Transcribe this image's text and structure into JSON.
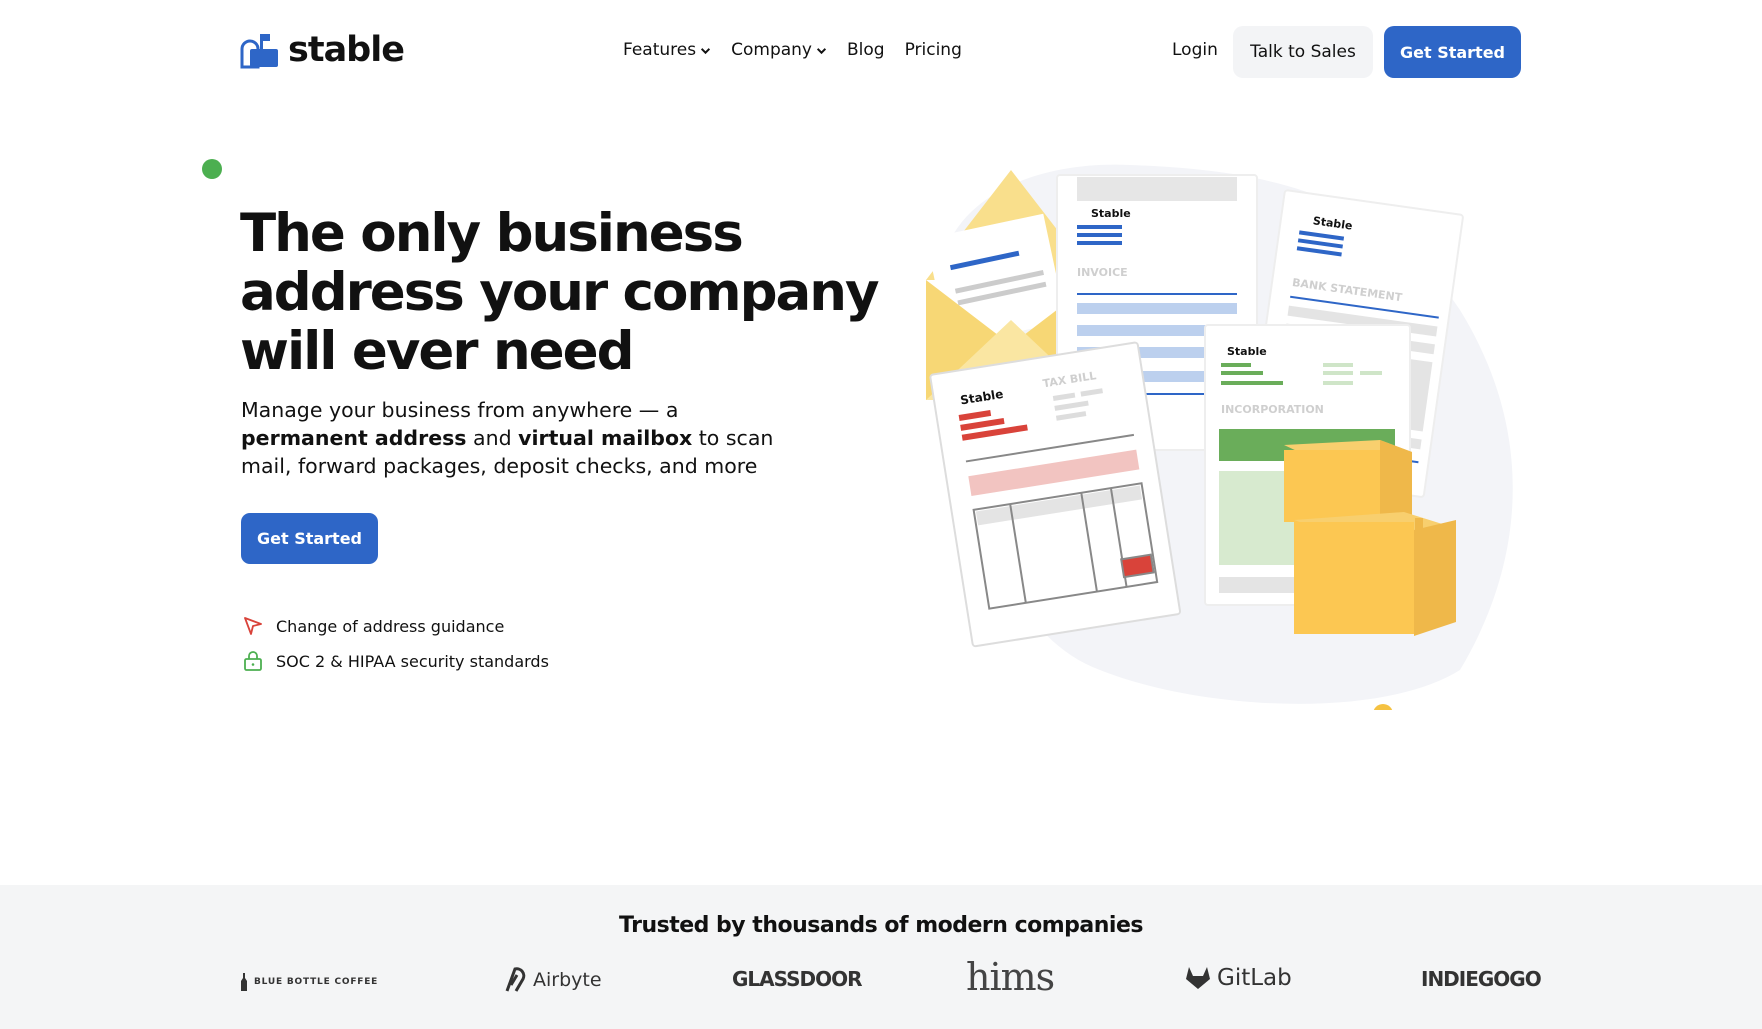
{
  "nav": {
    "logo_text": "stable",
    "menu": [
      {
        "label": "Features",
        "dropdown": true
      },
      {
        "label": "Company",
        "dropdown": true
      },
      {
        "label": "Blog",
        "dropdown": false
      },
      {
        "label": "Pricing",
        "dropdown": false
      }
    ],
    "login_label": "Login",
    "talk_label": "Talk to Sales",
    "start_label": "Get Started"
  },
  "hero": {
    "title": "The only business address your company will ever need",
    "subtitle_parts": [
      "Manage your business from anywhere — a ",
      "permanent address",
      " and ",
      "virtual mailbox",
      " to scan mail, forward packages, deposit checks, and more"
    ],
    "cta_label": "Get Started",
    "features": [
      {
        "icon": "cursor-arrow-icon",
        "text": "Change of address guidance"
      },
      {
        "icon": "lock-icon",
        "text": "SOC 2 & HIPAA security standards"
      }
    ]
  },
  "illustration": {
    "doc_brand": "Stable",
    "doc_labels": [
      "INVOICE",
      "BANK STATEMENT",
      "TAX BILL",
      "INCORPORATION"
    ]
  },
  "trusted": {
    "title": "Trusted by thousands of modern companies",
    "logos": [
      "BLUE BOTTLE COFFEE",
      "Airbyte",
      "GLASSDOOR",
      "hims",
      "GitLab",
      "INDIEGOGO"
    ]
  },
  "colors": {
    "brand_blue": "#2e66c7",
    "accent_green": "#4caf50",
    "accent_yellow": "#f5c242",
    "accent_red": "#d9433a"
  }
}
